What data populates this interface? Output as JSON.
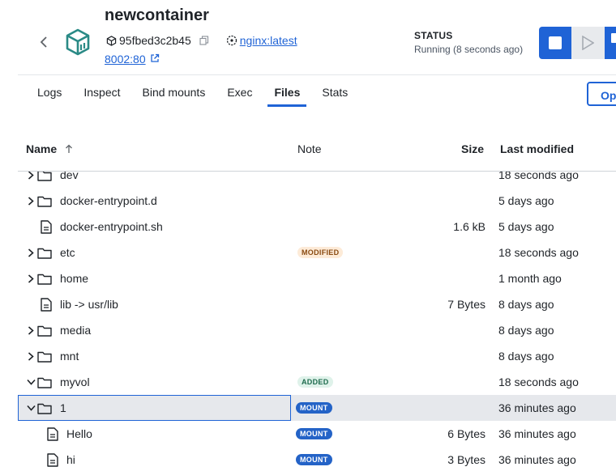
{
  "header": {
    "title": "newcontainer",
    "container_id": "95fbed3c2b45",
    "image": "nginx:latest",
    "port": "8002:80",
    "status_label": "STATUS",
    "status_value": "Running (8 seconds ago)"
  },
  "tabs": [
    {
      "label": "Logs",
      "active": false
    },
    {
      "label": "Inspect",
      "active": false
    },
    {
      "label": "Bind mounts",
      "active": false
    },
    {
      "label": "Exec",
      "active": false
    },
    {
      "label": "Files",
      "active": true
    },
    {
      "label": "Stats",
      "active": false
    }
  ],
  "open_button_label": "Ope",
  "table": {
    "columns": {
      "name": "Name",
      "note": "Note",
      "size": "Size",
      "modified": "Last modified"
    },
    "rows": [
      {
        "name": "dev",
        "type": "folder",
        "expandable": true,
        "expanded": false,
        "note": "",
        "size": "",
        "modified": "18 seconds ago"
      },
      {
        "name": "docker-entrypoint.d",
        "type": "folder",
        "expandable": true,
        "expanded": false,
        "note": "",
        "size": "",
        "modified": "5 days ago"
      },
      {
        "name": "docker-entrypoint.sh",
        "type": "file",
        "expandable": false,
        "note": "",
        "size": "1.6 kB",
        "modified": "5 days ago"
      },
      {
        "name": "etc",
        "type": "folder",
        "expandable": true,
        "expanded": false,
        "note": "MODIFIED",
        "size": "",
        "modified": "18 seconds ago"
      },
      {
        "name": "home",
        "type": "folder",
        "expandable": true,
        "expanded": false,
        "note": "",
        "size": "",
        "modified": "1 month ago"
      },
      {
        "name": "lib -> usr/lib",
        "type": "file",
        "expandable": false,
        "note": "",
        "size": "7 Bytes",
        "modified": "8 days ago"
      },
      {
        "name": "media",
        "type": "folder",
        "expandable": true,
        "expanded": false,
        "note": "",
        "size": "",
        "modified": "8 days ago"
      },
      {
        "name": "mnt",
        "type": "folder",
        "expandable": true,
        "expanded": false,
        "note": "",
        "size": "",
        "modified": "8 days ago"
      },
      {
        "name": "myvol",
        "type": "folder",
        "expandable": true,
        "expanded": true,
        "note": "ADDED",
        "size": "",
        "modified": "18 seconds ago"
      },
      {
        "name": "1",
        "type": "folder",
        "expandable": true,
        "expanded": true,
        "note": "MOUNT",
        "size": "",
        "modified": "36 minutes ago",
        "selected": true
      },
      {
        "name": "Hello",
        "type": "file",
        "expandable": false,
        "note": "MOUNT",
        "size": "6 Bytes",
        "modified": "36 minutes ago"
      },
      {
        "name": "hi",
        "type": "file",
        "expandable": false,
        "note": "MOUNT",
        "size": "3 Bytes",
        "modified": "36 minutes ago"
      }
    ]
  },
  "colors": {
    "accent": "#1f63d6",
    "logo": "#2a8a86",
    "modified_badge": "#fdebd8",
    "added_badge": "#dff2ea",
    "mount_badge": "#2463c7"
  }
}
